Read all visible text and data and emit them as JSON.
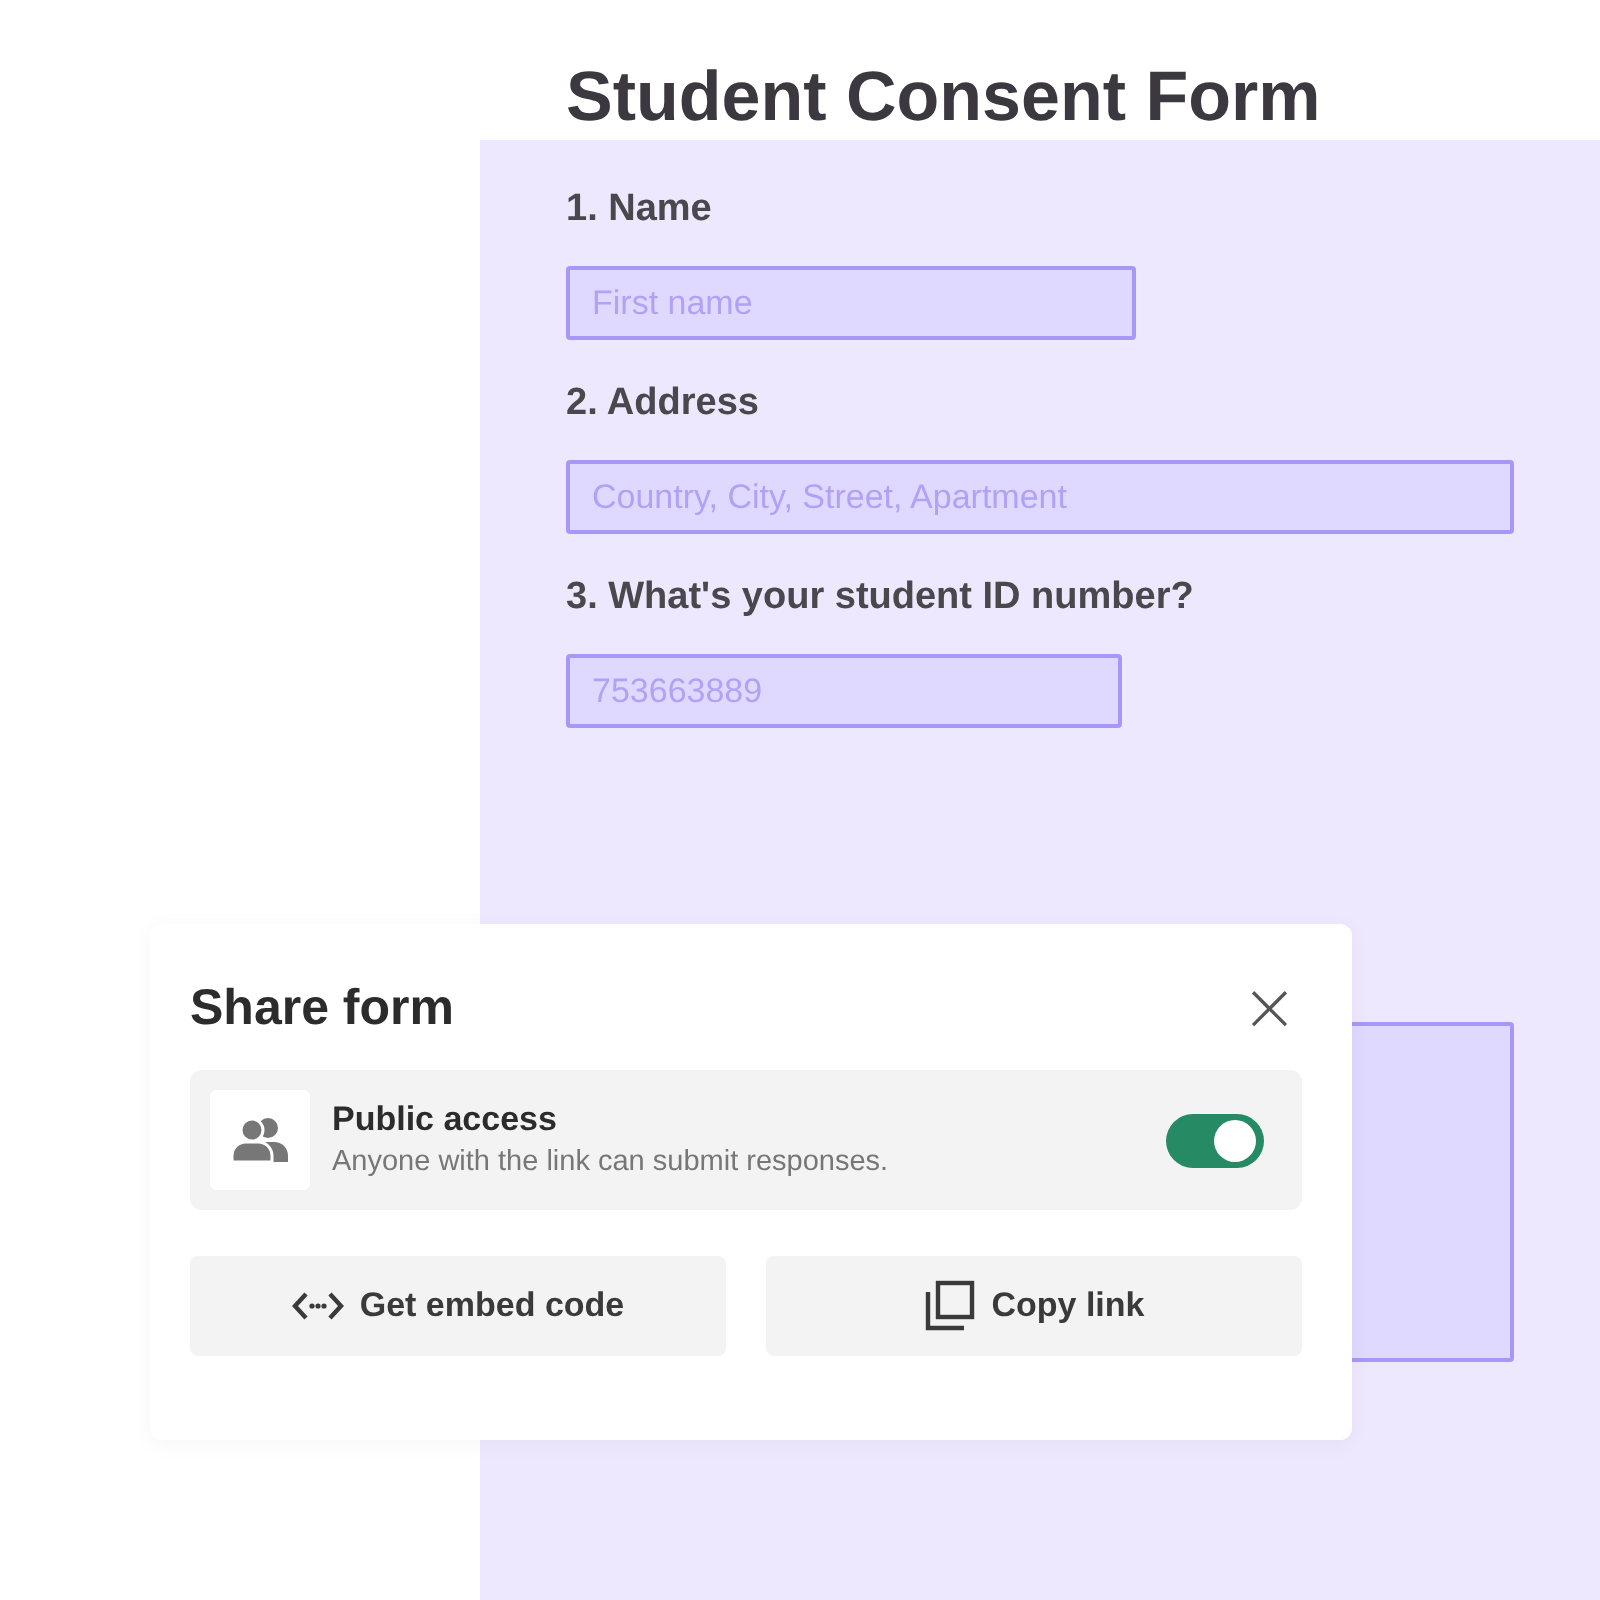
{
  "form": {
    "title": "Student Consent Form",
    "questions": [
      {
        "kind": "short",
        "label": "1. Name",
        "placeholder": "First name"
      },
      {
        "kind": "wide",
        "label": "2. Address",
        "placeholder": "Country, City, Street, Apartment"
      },
      {
        "kind": "short",
        "label": "3. What's your student ID number?",
        "placeholder": "753663889"
      },
      {
        "kind": "long"
      }
    ]
  },
  "share_dialog": {
    "title": "Share form",
    "close": "×",
    "access": {
      "title": "Public access",
      "description": "Anyone with the link can submit responses.",
      "on": true
    },
    "buttons": [
      {
        "kind": "embed",
        "label": "Get embed code"
      },
      {
        "kind": "copy",
        "label": "Copy link"
      }
    ]
  }
}
